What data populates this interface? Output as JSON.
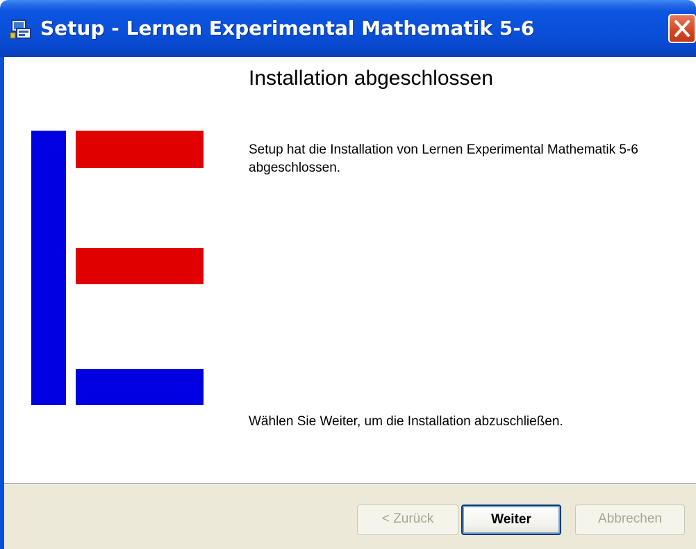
{
  "window": {
    "title": "Setup - Lernen Experimental Mathematik 5-6",
    "app_icon": "setup-installer-icon",
    "close_icon": "close-icon"
  },
  "main": {
    "heading": "Installation abgeschlossen",
    "body": "Setup hat die Installation von Lernen Experimental Mathematik 5-6 abgeschlossen.",
    "footer": "Wählen Sie Weiter, um die Installation abzuschließen."
  },
  "buttons": {
    "back": "< Zurück",
    "next": "Weiter",
    "cancel": "Abbrechen"
  },
  "colors": {
    "logo_blue": "#0000e0",
    "logo_red": "#e00000",
    "titlebar_blue": "#0a4fd8",
    "button_bar": "#ece9d8"
  }
}
